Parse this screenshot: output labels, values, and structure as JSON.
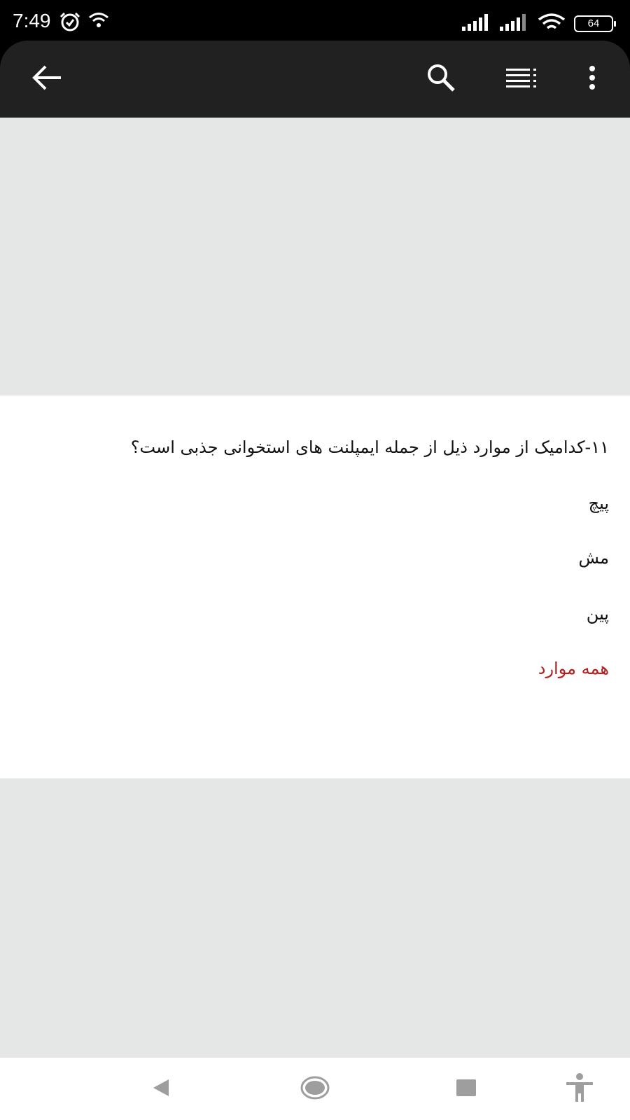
{
  "status_bar": {
    "time": "7:49",
    "battery": "64"
  },
  "app_bar": {
    "back_icon": "arrow-left-icon",
    "search_icon": "search-icon",
    "list_icon": "list-icon",
    "more_icon": "more-vert-icon"
  },
  "question": {
    "text": "۱۱-کدامیک از موارد ذیل از جمله ایمپلنت های استخوانی جذبی است؟",
    "options": [
      "پیچ",
      "مش",
      "پین",
      "همه موارد"
    ],
    "answer_color": "#b71c1c"
  },
  "nav_bar": {
    "back_icon": "nav-back-icon",
    "home_icon": "nav-home-icon",
    "recents_icon": "nav-recents-icon",
    "accessibility_icon": "accessibility-icon"
  }
}
